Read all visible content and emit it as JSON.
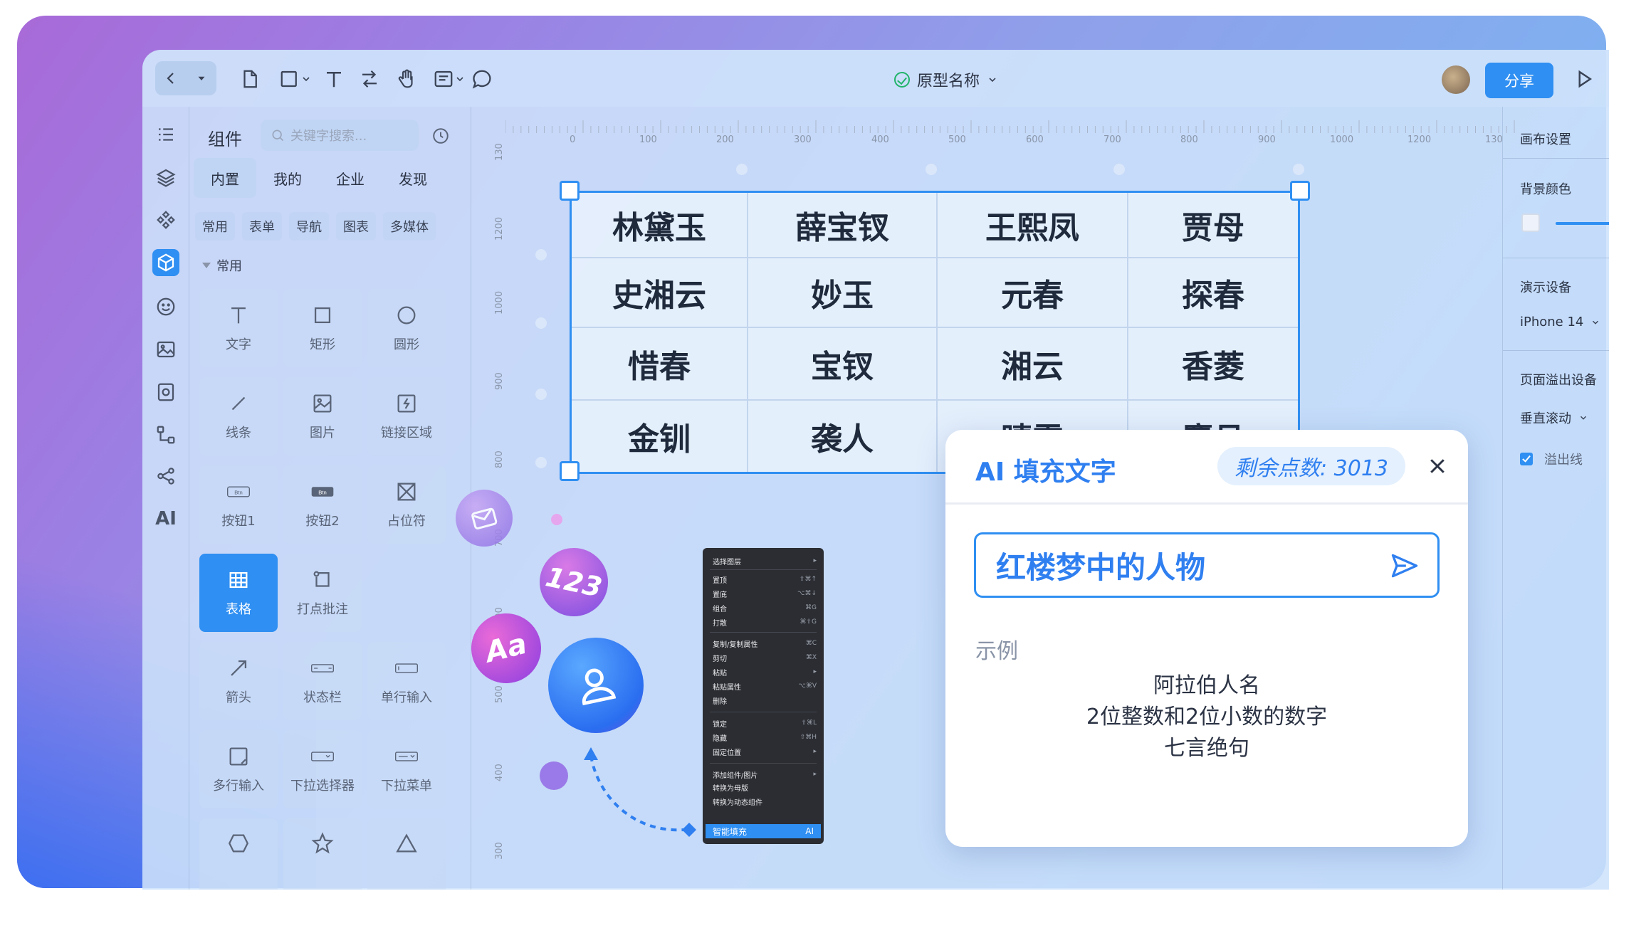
{
  "toolbar": {
    "project_name": "原型名称",
    "share_label": "分享"
  },
  "components_panel": {
    "title": "组件",
    "search_placeholder": "关键字搜索...",
    "tabs": [
      "内置",
      "我的",
      "企业",
      "发现"
    ],
    "chips": [
      "常用",
      "表单",
      "导航",
      "图表",
      "多媒体"
    ],
    "section_label": "常用",
    "items": [
      {
        "label": "文字",
        "icon": "text-icon"
      },
      {
        "label": "矩形",
        "icon": "rectangle-icon"
      },
      {
        "label": "圆形",
        "icon": "circle-icon"
      },
      {
        "label": "线条",
        "icon": "line-icon"
      },
      {
        "label": "图片",
        "icon": "image-icon"
      },
      {
        "label": "链接区域",
        "icon": "link-area-icon"
      },
      {
        "label": "按钮1",
        "icon": "button1-icon"
      },
      {
        "label": "按钮2",
        "icon": "button2-icon"
      },
      {
        "label": "占位符",
        "icon": "placeholder-icon"
      },
      {
        "label": "表格",
        "icon": "table-icon"
      },
      {
        "label": "打点批注",
        "icon": "annotation-icon"
      },
      {
        "label": "箭头",
        "icon": "arrow-icon"
      },
      {
        "label": "状态栏",
        "icon": "statusbar-icon"
      },
      {
        "label": "单行输入",
        "icon": "single-input-icon"
      },
      {
        "label": "多行输入",
        "icon": "multi-input-icon"
      },
      {
        "label": "下拉选择器",
        "icon": "dropdown-selector-icon"
      },
      {
        "label": "下拉菜单",
        "icon": "dropdown-menu-icon"
      }
    ],
    "btn_icon_text": "Btn"
  },
  "left_rail": {
    "ai_label": "AI"
  },
  "rulers": {
    "top": [
      "0",
      "100",
      "200",
      "300",
      "400",
      "500",
      "600",
      "700",
      "800",
      "900",
      "1000",
      "1200",
      "130"
    ],
    "left": [
      "130",
      "1200",
      "1000",
      "900",
      "800",
      "700",
      "600",
      "500",
      "400",
      "300"
    ]
  },
  "canvas_table": {
    "rows": [
      [
        "林黛玉",
        "薛宝钗",
        "王熙凤",
        "贾母"
      ],
      [
        "史湘云",
        "妙玉",
        "元春",
        "探春"
      ],
      [
        "惜春",
        "宝钗",
        "湘云",
        "香菱"
      ],
      [
        "金钏",
        "袭人",
        "晴雯",
        "麝月"
      ]
    ]
  },
  "bubbles": {
    "numbers": "123",
    "text": "Aa"
  },
  "context_menu": {
    "items": [
      {
        "label": "选择图层",
        "key": "▸"
      },
      {
        "label": "置顶",
        "key": "⇧⌘↑"
      },
      {
        "label": "置底",
        "key": "⌥⌘↓"
      },
      {
        "label": "组合",
        "key": "⌘G"
      },
      {
        "label": "打散",
        "key": "⌘⇧G"
      },
      {
        "label": "复制/复制属性",
        "key": "⌘C"
      },
      {
        "label": "剪切",
        "key": "⌘X"
      },
      {
        "label": "粘贴",
        "key": "▸"
      },
      {
        "label": "粘贴属性",
        "key": "⌥⌘V"
      },
      {
        "label": "删除",
        "key": ""
      },
      {
        "label": "锁定",
        "key": "⇧⌘L"
      },
      {
        "label": "隐藏",
        "key": "⇧⌘H"
      },
      {
        "label": "固定位置",
        "key": "▸"
      },
      {
        "label": "添加组件/图片",
        "key": "▸"
      },
      {
        "label": "转换为母版",
        "key": ""
      },
      {
        "label": "转换为动态组件",
        "key": ""
      }
    ],
    "highlighted": {
      "label": "智能填充",
      "key": "AI"
    }
  },
  "right_panel": {
    "canvas_settings": "画布设置",
    "bg_color": "背景颜色",
    "device_label": "演示设备",
    "device_value": "iPhone 14",
    "overflow_label": "页面溢出设备",
    "scroll_value": "垂直滚动",
    "overflow_line": "溢出线",
    "overflow_line_checked": true
  },
  "ai_fill": {
    "title": "AI 填充文字",
    "points": "剩余点数: 3013",
    "input_value": "红楼梦中的人物",
    "example_label": "示例",
    "examples": [
      "阿拉伯人名",
      "2位整数和2位小数的数字",
      "七言绝句"
    ]
  },
  "colors": {
    "accent": "#2f8ff2",
    "success": "#21b46a"
  }
}
